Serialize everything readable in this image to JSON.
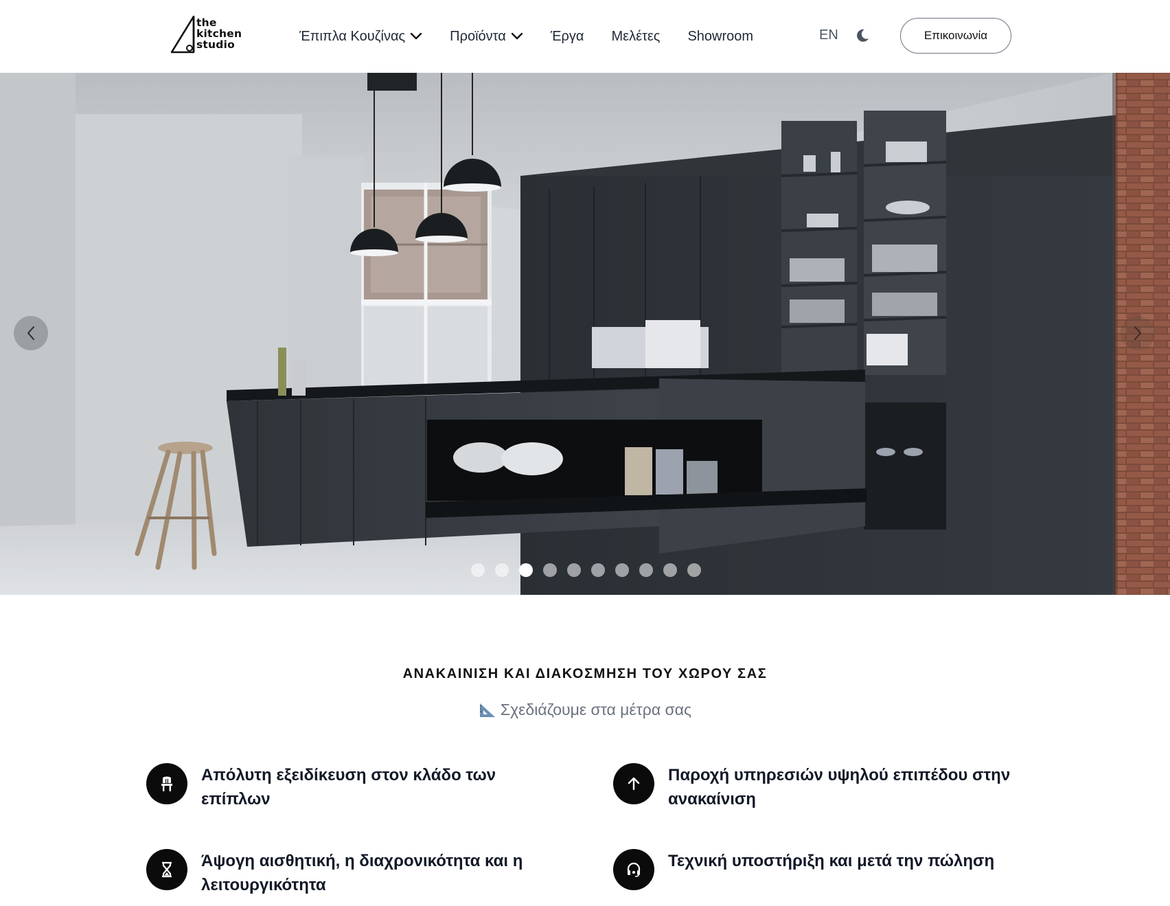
{
  "header": {
    "logo": {
      "lines": [
        "the",
        "kitchen",
        "studio"
      ]
    },
    "nav": [
      {
        "label": "Έπιπλα Κουζίνας",
        "has_dropdown": true
      },
      {
        "label": "Προϊόντα",
        "has_dropdown": true
      },
      {
        "label": "Έργα",
        "has_dropdown": false
      },
      {
        "label": "Μελέτες",
        "has_dropdown": false
      },
      {
        "label": "Showroom",
        "has_dropdown": false
      }
    ],
    "language": "EN",
    "theme_icon": "moon-icon",
    "contact_label": "Επικοινωνία"
  },
  "hero": {
    "prev_icon": "chevron-left-icon",
    "next_icon": "chevron-right-icon",
    "slide_count": 10,
    "active_slide": 3
  },
  "intro": {
    "title": "ΑΝΑΚΑΙΝΙΣΗ ΚΑΙ ΔΙΑΚΟΣΜΗΣΗ ΤΟΥ ΧΩΡΟΥ ΣΑΣ",
    "subtitle_icon": "triangular-ruler-icon",
    "subtitle": "Σχεδιάζουμε στα μέτρα σας"
  },
  "features": [
    {
      "icon": "chair-icon",
      "text": "Απόλυτη εξειδίκευση στον κλάδο των επίπλων"
    },
    {
      "icon": "arrow-up-icon",
      "text": "Παροχή υπηρεσιών υψηλού επιπέδου στην ανακαίνιση"
    },
    {
      "icon": "hourglass-icon",
      "text": "Άψογη αισθητική, η διαχρονικότητα και η λειτουργικότητα"
    },
    {
      "icon": "headset-icon",
      "text": "Τεχνική υποστήριξη και μετά την πώληση"
    }
  ],
  "colors": {
    "text": "#111827",
    "muted": "#6b7280",
    "icon_bg": "#0b0b0b",
    "cabinet": "#2e3338"
  }
}
